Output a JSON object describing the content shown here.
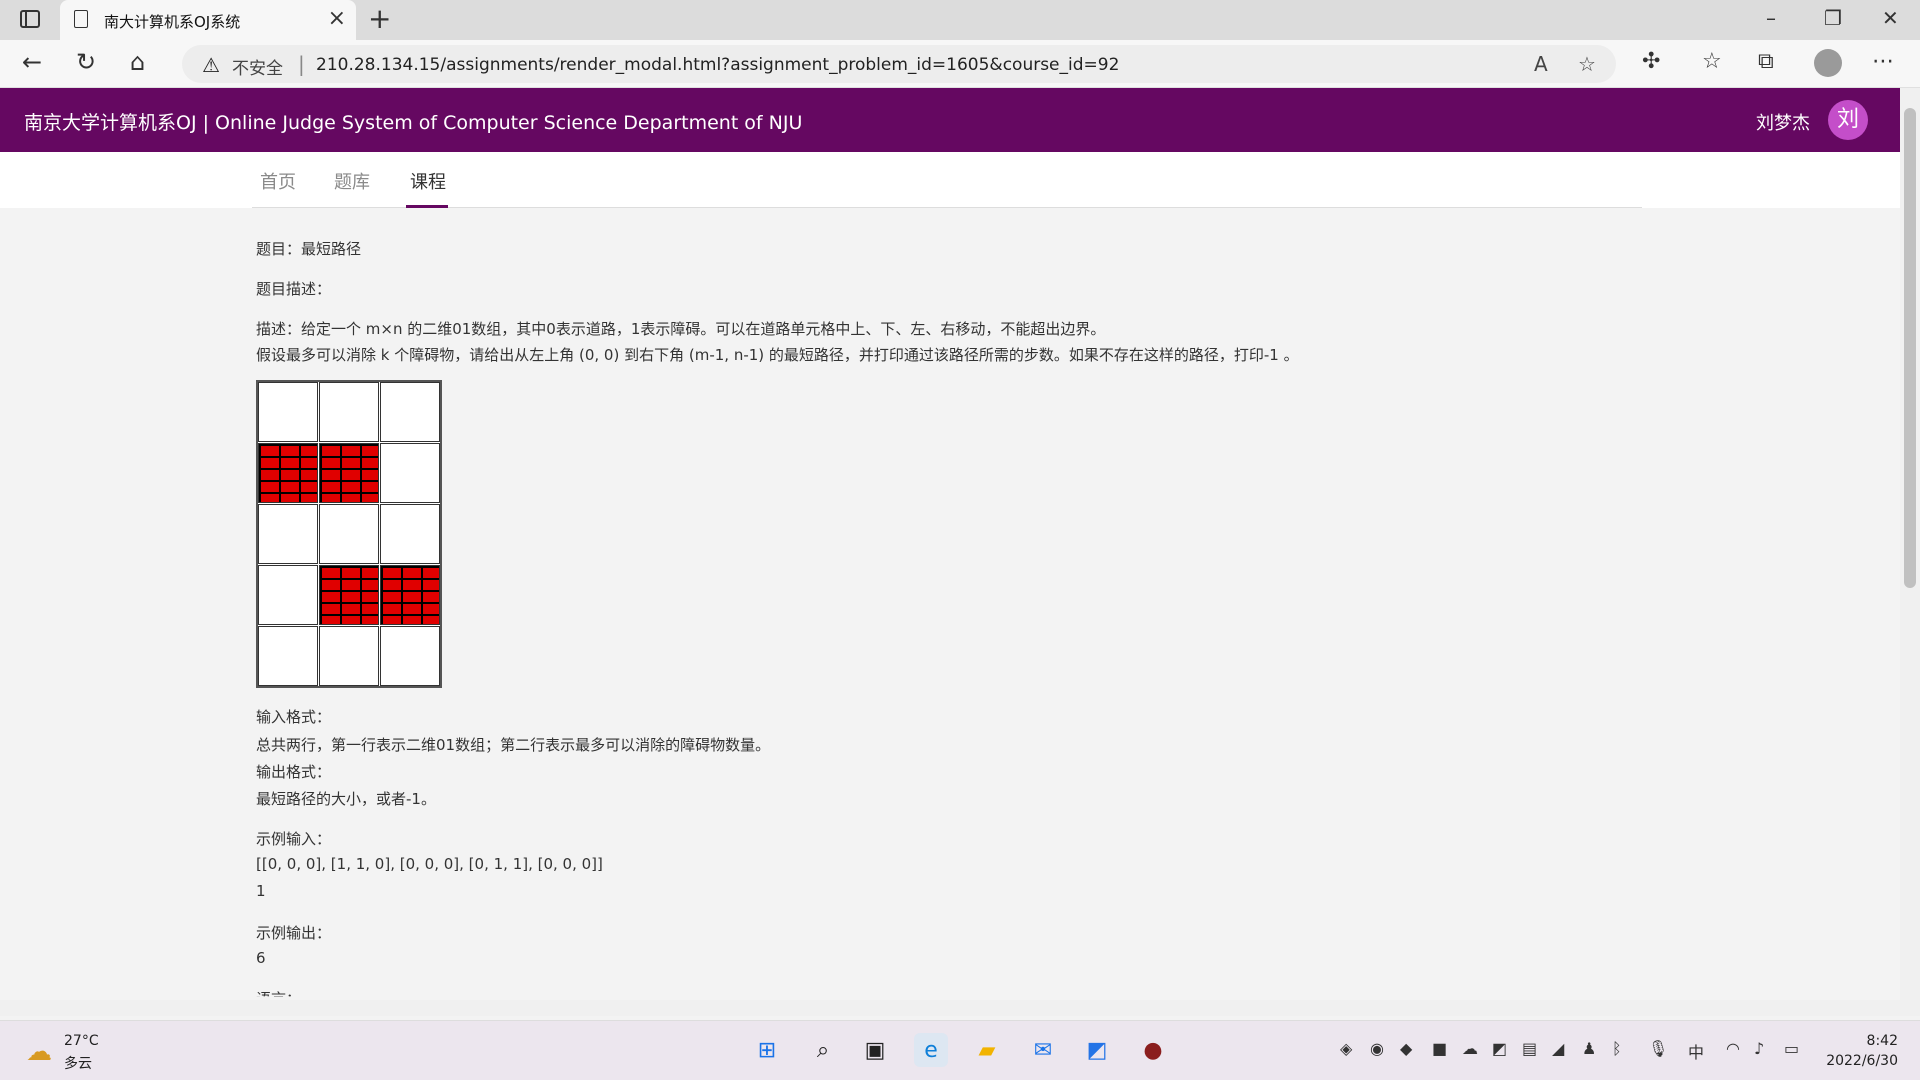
{
  "browser": {
    "tab_title": "南大计算机系OJ系统",
    "tab_close": "×",
    "new_tab": "+",
    "security_label": "不安全",
    "url": "210.28.134.15/assignments/render_modal.html?assignment_problem_id=1605&course_id=92",
    "win_min": "–",
    "win_max": "❐",
    "win_close": "✕"
  },
  "site": {
    "title": "南京大学计算机系OJ | Online Judge System of Computer Science Department of NJU",
    "user_name": "刘梦杰",
    "avatar_text": "刘",
    "nav": [
      "首页",
      "题库",
      "课程"
    ],
    "active_nav": "课程"
  },
  "problem": {
    "title": "题目：最短路径",
    "desc_label": "题目描述：",
    "desc_line1": "描述：给定一个 m×n 的二维01数组，其中0表示道路，1表示障碍。可以在道路单元格中上、下、左、右移动，不能超出边界。",
    "desc_line2": "假设最多可以消除 k 个障碍物，请给出从左上角 (0, 0) 到右下角 (m-1, n-1) 的最短路径，并打印通过该路径所需的步数。如果不存在这样的路径，打印-1 。",
    "grid": [
      [
        0,
        0,
        0
      ],
      [
        1,
        1,
        0
      ],
      [
        0,
        0,
        0
      ],
      [
        0,
        1,
        1
      ],
      [
        0,
        0,
        0
      ]
    ],
    "input_label": "输入格式：",
    "input_desc": "总共两行，第一行表示二维01数组；第二行表示最多可以消除的障碍物数量。",
    "output_label": "输出格式：",
    "output_desc": "最短路径的大小，或者-1。",
    "sample_input_label": "示例输入：",
    "sample_input_line1": "[[0, 0, 0], [1, 1, 0], [0, 0, 0], [0, 1, 1], [0, 0, 0]]",
    "sample_input_line2": "1",
    "sample_output_label": "示例输出：",
    "sample_output": "6",
    "language_label": "语言："
  },
  "taskbar": {
    "temperature": "27°C",
    "condition": "多云",
    "ime": "中",
    "time": "8:42",
    "date": "2022/6/30"
  },
  "icons": {
    "back": "back-arrow-icon",
    "refresh": "refresh-icon",
    "home": "home-icon",
    "warning": "warning-icon"
  }
}
